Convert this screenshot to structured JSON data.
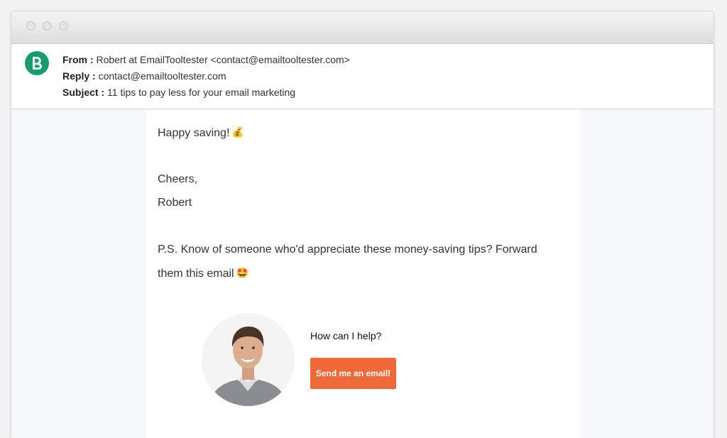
{
  "header": {
    "avatar_letter": "B",
    "from_label": "From :",
    "from_value": "Robert at EmailTooltester <contact@emailtooltester.com>",
    "reply_label": "Reply :",
    "reply_value": "contact@emailtooltester.com",
    "subject_label": "Subject :",
    "subject_value": "11 tips to pay less for your email marketing"
  },
  "body": {
    "line1": "Happy saving!",
    "line1_emoji": "💰",
    "line2": "Cheers,",
    "line3": "Robert",
    "line4": "P.S. Know of someone who'd appreciate these money-saving tips? Forward them this email",
    "line4_emoji": "🤩"
  },
  "cta": {
    "help_text": "How can I help?",
    "button_label": "Send me an email!"
  },
  "colors": {
    "avatar": "#1a9b6c",
    "button": "#ee6a3a",
    "background": "#f7f8fa"
  },
  "icons": {
    "avatar": "brevo-logo-icon",
    "window_controls": [
      "close-dot",
      "minimize-dot",
      "zoom-dot"
    ]
  }
}
